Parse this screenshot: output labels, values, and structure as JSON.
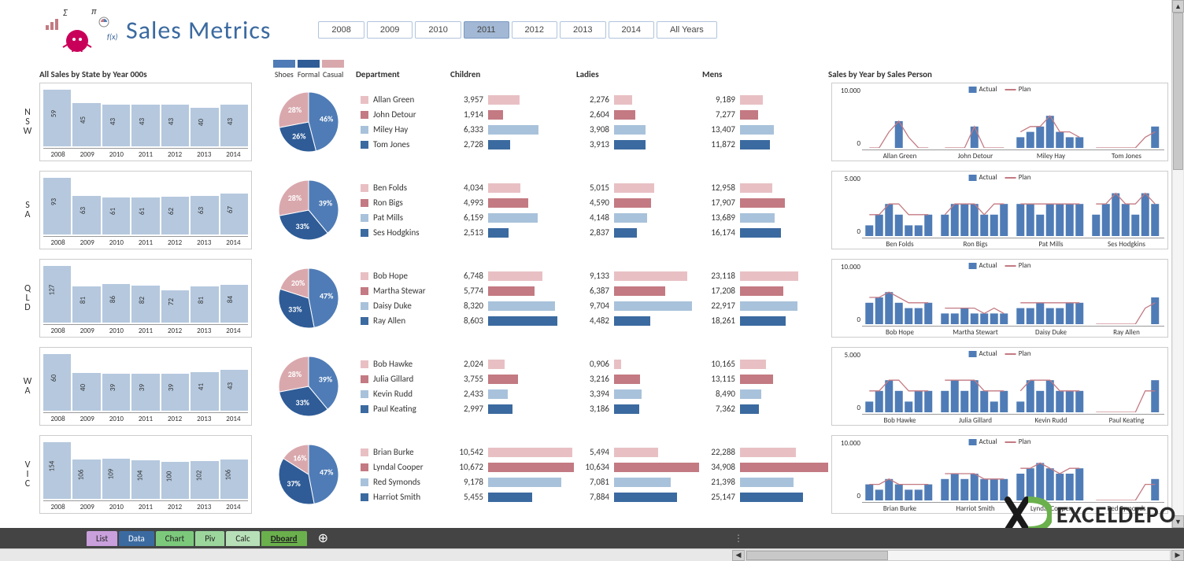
{
  "header": {
    "title": "Sales Metrics"
  },
  "watermark": {
    "text": "EXCELDEPO"
  },
  "year_filter": {
    "options": [
      "2008",
      "2009",
      "2010",
      "2011",
      "2012",
      "2013",
      "2014",
      "All Years"
    ],
    "selected": "2011"
  },
  "legend": {
    "shoes": "Shoes",
    "formal": "Formal",
    "casual": "Casual",
    "actual": "Actual",
    "plan": "Plan"
  },
  "headers": {
    "sales_by_state": "All Sales by State by Year 000s",
    "department": "Department",
    "children": "Children",
    "ladies": "Ladies",
    "mens": "Mens",
    "by_person": "Sales by Year by Sales Person"
  },
  "tabs": [
    {
      "label": "List",
      "color": "#c9a0dc"
    },
    {
      "label": "Data",
      "color": "#3b6aa0",
      "text": "#fff"
    },
    {
      "label": "Chart",
      "color": "#7cc97c"
    },
    {
      "label": "Piv",
      "color": "#9cd69c"
    },
    {
      "label": "Calc",
      "color": "#b8e0b8"
    },
    {
      "label": "Dboard",
      "color": "#6ab04c",
      "active": true
    }
  ],
  "chart_data": {
    "by_state_year": {
      "type": "bar",
      "years": [
        "2008",
        "2009",
        "2010",
        "2011",
        "2012",
        "2013",
        "2014"
      ],
      "NSW": [
        59,
        45,
        43,
        43,
        43,
        40,
        43
      ],
      "SA": [
        93,
        63,
        61,
        61,
        62,
        63,
        67
      ],
      "QLD": [
        127,
        81,
        86,
        82,
        72,
        81,
        84
      ],
      "WA": [
        60,
        40,
        39,
        39,
        39,
        41,
        43
      ],
      "VIC": [
        154,
        106,
        109,
        104,
        100,
        102,
        106
      ]
    },
    "pies": {
      "type": "pie",
      "NSW": {
        "shoes": 46,
        "formal": 26,
        "casual": 28
      },
      "SA": {
        "shoes": 39,
        "formal": 33,
        "casual": 28
      },
      "QLD": {
        "shoes": 47,
        "formal": 33,
        "casual": 20
      },
      "WA": {
        "shoes": 39,
        "formal": 33,
        "casual": 28
      },
      "VIC": {
        "shoes": 47,
        "formal": 37,
        "casual": 16
      }
    },
    "dept_bars": {
      "type": "bar",
      "child_max": 11,
      "ladies_max": 11,
      "mens_max": 35
    },
    "spark": {
      "type": "bar+line",
      "ymax": {
        "NSW": 10.0,
        "SA": 5.0,
        "QLD": 10.0,
        "WA": 5.0,
        "VIC": 10.0
      },
      "series": [
        "Actual",
        "Plan"
      ]
    }
  },
  "states": [
    {
      "code": "NSW",
      "label": [
        "N",
        "S",
        "W"
      ],
      "people": [
        {
          "name": "Allan Green",
          "children": 3.957,
          "ladies": 2.276,
          "mens": 9.189
        },
        {
          "name": "John Detour",
          "children": 1.914,
          "ladies": 2.604,
          "mens": 7.277
        },
        {
          "name": "Miley Hay",
          "children": 6.333,
          "ladies": 3.908,
          "mens": 13.407
        },
        {
          "name": "Tom Jones",
          "children": 2.728,
          "ladies": 3.913,
          "mens": 11.872
        }
      ],
      "spark_actual": [
        [
          0,
          0,
          0,
          5,
          0,
          0,
          0
        ],
        [
          0,
          0,
          0,
          4,
          0,
          0,
          0
        ],
        [
          2,
          3,
          4,
          6,
          3,
          2,
          2
        ],
        [
          0,
          0,
          0,
          0,
          0,
          0,
          4
        ]
      ],
      "spark_plan": [
        [
          0,
          0,
          3,
          5,
          2,
          0,
          0
        ],
        [
          0,
          0,
          0,
          4,
          0,
          0,
          0
        ],
        [
          3,
          4,
          4,
          6,
          3,
          3,
          2
        ],
        [
          0,
          0,
          0,
          0,
          0,
          2,
          3
        ]
      ]
    },
    {
      "code": "SA",
      "label": [
        "S",
        "A"
      ],
      "people": [
        {
          "name": "Ben Folds",
          "children": 4.034,
          "ladies": 5.015,
          "mens": 12.958
        },
        {
          "name": "Ron Bigs",
          "children": 4.993,
          "ladies": 4.59,
          "mens": 17.907
        },
        {
          "name": "Pat Mills",
          "children": 6.159,
          "ladies": 4.148,
          "mens": 13.689
        },
        {
          "name": "Ses Hodgkins",
          "children": 2.513,
          "ladies": 2.837,
          "mens": 16.174
        }
      ],
      "spark_actual": [
        [
          1,
          2,
          3,
          2,
          1,
          1,
          2
        ],
        [
          2,
          3,
          3,
          3,
          2,
          2,
          3
        ],
        [
          3,
          3,
          2,
          3,
          3,
          3,
          3
        ],
        [
          2,
          3,
          4,
          3,
          2,
          4,
          3
        ]
      ],
      "spark_plan": [
        [
          2,
          2,
          3,
          3,
          2,
          2,
          2
        ],
        [
          2,
          3,
          3,
          3,
          2,
          3,
          3
        ],
        [
          3,
          3,
          3,
          3,
          3,
          3,
          3
        ],
        [
          3,
          3,
          4,
          3,
          3,
          4,
          3
        ]
      ]
    },
    {
      "code": "QLD",
      "label": [
        "Q",
        "L",
        "D"
      ],
      "people": [
        {
          "name": "Bob Hope",
          "children": 6.748,
          "ladies": 9.133,
          "mens": 23.118
        },
        {
          "name": "Martha Stewar",
          "children": 5.774,
          "ladies": 6.387,
          "mens": 17.208
        },
        {
          "name": "Daisy Duke",
          "children": 8.32,
          "ladies": 9.704,
          "mens": 22.917
        },
        {
          "name": "Ray Allen",
          "children": 8.603,
          "ladies": 4.482,
          "mens": 18.261
        }
      ],
      "spark_headers": [
        "Bob Hope",
        "Martha Stewart",
        "Daisy Duke",
        "Ray Allen"
      ],
      "spark_actual": [
        [
          4,
          5,
          6,
          4,
          3,
          3,
          4
        ],
        [
          2,
          2,
          3,
          2,
          2,
          2,
          2
        ],
        [
          3,
          3,
          4,
          3,
          3,
          4,
          4
        ],
        [
          0,
          0,
          0,
          0,
          0,
          0,
          5
        ]
      ],
      "spark_plan": [
        [
          5,
          5,
          6,
          5,
          4,
          4,
          4
        ],
        [
          3,
          3,
          3,
          3,
          2,
          3,
          2
        ],
        [
          4,
          4,
          4,
          4,
          4,
          4,
          4
        ],
        [
          0,
          0,
          0,
          0,
          0,
          3,
          4
        ]
      ]
    },
    {
      "code": "WA",
      "label": [
        "W",
        "A"
      ],
      "people": [
        {
          "name": "Bob Hawke",
          "children": 2.024,
          "ladies": 0.906,
          "mens": 10.165
        },
        {
          "name": "Julia Gillard",
          "children": 3.755,
          "ladies": 3.216,
          "mens": 13.115
        },
        {
          "name": "Kevin Rudd",
          "children": 2.433,
          "ladies": 3.394,
          "mens": 8.49
        },
        {
          "name": "Paul Keating",
          "children": 2.997,
          "ladies": 3.186,
          "mens": 7.362
        }
      ],
      "spark_actual": [
        [
          1,
          2,
          3,
          2,
          1,
          2,
          2
        ],
        [
          2,
          3,
          2,
          3,
          2,
          1,
          2
        ],
        [
          1,
          3,
          2,
          3,
          2,
          2,
          2
        ],
        [
          0,
          0,
          0,
          0,
          0,
          0,
          3
        ]
      ],
      "spark_plan": [
        [
          2,
          2,
          3,
          3,
          2,
          2,
          2
        ],
        [
          3,
          3,
          3,
          3,
          2,
          2,
          2
        ],
        [
          2,
          3,
          3,
          3,
          2,
          2,
          2
        ],
        [
          0,
          0,
          0,
          0,
          0,
          2,
          2
        ]
      ]
    },
    {
      "code": "VIC",
      "label": [
        "V",
        "I",
        "C"
      ],
      "people": [
        {
          "name": "Brian Burke",
          "children": 10.542,
          "ladies": 5.494,
          "mens": 22.288
        },
        {
          "name": "Lyndal Cooper",
          "children": 10.672,
          "ladies": 10.634,
          "mens": 34.908
        },
        {
          "name": "Red Symonds",
          "children": 9.178,
          "ladies": 7.081,
          "mens": 21.398
        },
        {
          "name": "Harriot Smith",
          "children": 5.455,
          "ladies": 7.884,
          "mens": 25.147
        }
      ],
      "spark_headers": [
        "Brian Burke",
        "Harriot Smith",
        "Lyndal Cooper",
        "Red Symonds"
      ],
      "spark_actual": [
        [
          3,
          2,
          4,
          3,
          2,
          2,
          3
        ],
        [
          4,
          5,
          4,
          5,
          4,
          4,
          4
        ],
        [
          5,
          6,
          7,
          6,
          5,
          5,
          6
        ],
        [
          0,
          0,
          0,
          0,
          0,
          0,
          4
        ]
      ],
      "spark_plan": [
        [
          3,
          3,
          4,
          3,
          3,
          3,
          3
        ],
        [
          5,
          5,
          5,
          5,
          4,
          4,
          4
        ],
        [
          6,
          6,
          7,
          6,
          5,
          6,
          6
        ],
        [
          0,
          0,
          0,
          0,
          0,
          3,
          3
        ]
      ]
    }
  ]
}
